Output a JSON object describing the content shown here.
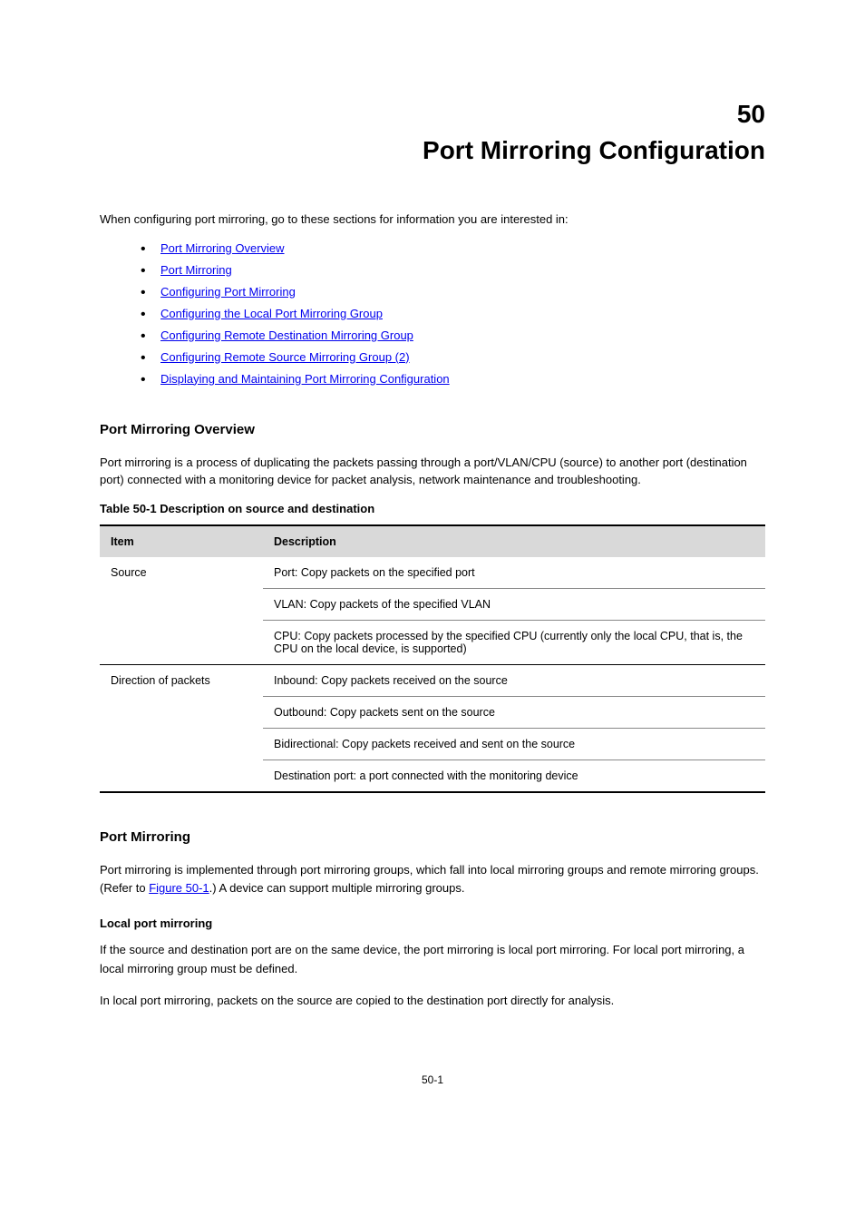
{
  "chapter": {
    "number": "50",
    "title": "Port Mirroring Configuration"
  },
  "intro": "When configuring port mirroring, go to these sections for information you are interested in:",
  "links": [
    "Port Mirroring Overview",
    "Port Mirroring",
    "Configuring Port Mirroring",
    "Configuring the Local Port Mirroring Group",
    "Configuring Remote Destination Mirroring Group",
    "Configuring Remote Source Mirroring Group (2)",
    "Displaying and Maintaining Port Mirroring Configuration"
  ],
  "section1": {
    "title": "Port Mirroring Overview",
    "text": "Port mirroring is a process of duplicating the packets passing through a port/VLAN/CPU (source) to another port (destination port) connected with a monitoring device for packet analysis, network maintenance and troubleshooting.",
    "tableCaption": "Table 50-1 Description on source and destination",
    "tableHeaders": {
      "col1": "Item",
      "col2": "Description"
    },
    "tableGroups": [
      {
        "label": "Source",
        "rows": [
          "Port: Copy packets on the specified port",
          "VLAN: Copy packets of the specified VLAN",
          "CPU: Copy packets processed by the specified CPU (currently only the local CPU, that is, the CPU on the local device, is supported)"
        ]
      },
      {
        "label": "Direction of packets",
        "rows": [
          "Inbound: Copy packets received on the source",
          "Outbound: Copy packets sent on the source",
          "Bidirectional: Copy packets received and sent on the source",
          "Destination port: a port connected with the monitoring device"
        ]
      }
    ]
  },
  "section2": {
    "title": "Port Mirroring",
    "para1_prefix": "Port mirroring is implemented through port mirroring groups, which fall into local mirroring groups and remote mirroring groups. (Refer to ",
    "para1_link": "Figure 50-1",
    "para1_suffix": ".) A device can support multiple mirroring groups.",
    "sub_title": "Local port mirroring",
    "para2": "If the source and destination port are on the same device, the port mirroring is local port mirroring. For local port mirroring, a local mirroring group must be defined.",
    "para3": "In local port mirroring, packets on the source are copied to the destination port directly for analysis."
  },
  "footer": "50-1"
}
